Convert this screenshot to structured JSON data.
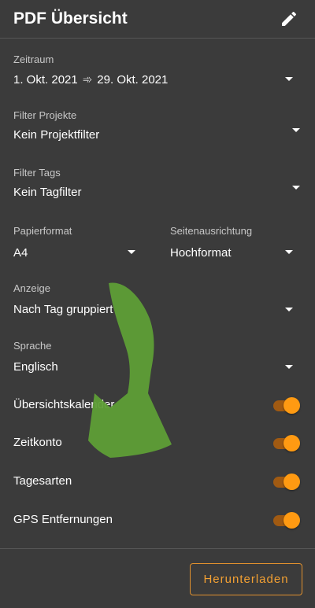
{
  "header": {
    "title": "PDF Übersicht",
    "edit_icon": "pencil-icon"
  },
  "fields": {
    "zeitraum": {
      "label": "Zeitraum",
      "start": "1. Okt. 2021",
      "arrow": "➾",
      "end": "29. Okt. 2021"
    },
    "filter_projekte": {
      "label": "Filter Projekte",
      "value": "Kein Projektfilter"
    },
    "filter_tags": {
      "label": "Filter Tags",
      "value": "Kein Tagfilter"
    },
    "papierformat": {
      "label": "Papierformat",
      "value": "A4"
    },
    "seitenausrichtung": {
      "label": "Seitenausrichtung",
      "value": "Hochformat"
    },
    "anzeige": {
      "label": "Anzeige",
      "value": "Nach Tag gruppiert"
    },
    "sprache": {
      "label": "Sprache",
      "value": "Englisch"
    }
  },
  "toggles": [
    {
      "label": "Übersichtskalender",
      "on": true
    },
    {
      "label": "Zeitkonto",
      "on": true
    },
    {
      "label": "Tagesarten",
      "on": true
    },
    {
      "label": "GPS Entfernungen",
      "on": true
    }
  ],
  "footer": {
    "download_label": "Herunterladen"
  },
  "colors": {
    "background": "#3b3b3b",
    "accent": "#ff9a12",
    "accent_track": "#a05a12",
    "annotation_arrow": "#5e9e36"
  }
}
